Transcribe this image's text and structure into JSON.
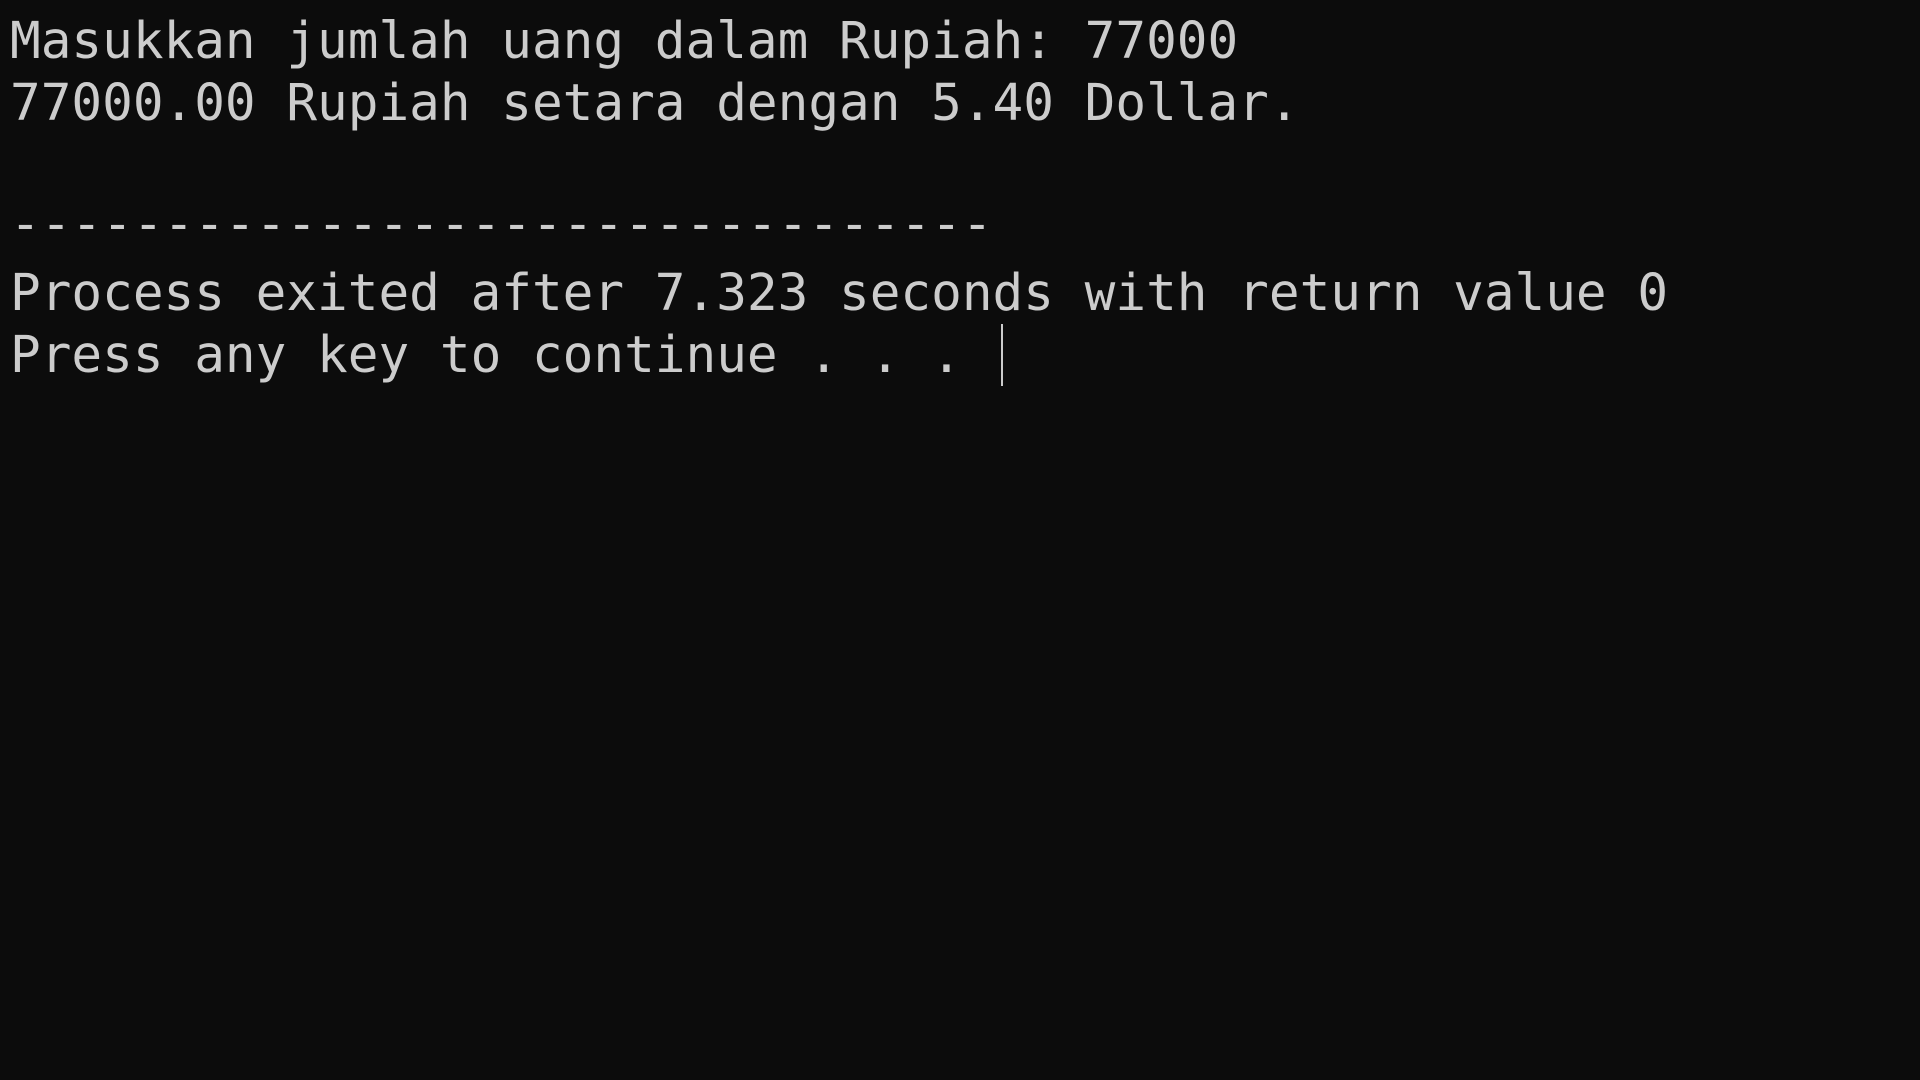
{
  "console": {
    "lines": [
      "Masukkan jumlah uang dalam Rupiah: 77000",
      "77000.00 Rupiah setara dengan 5.40 Dollar.",
      "--------------------------------",
      "Process exited after 7.323 seconds with return value 0",
      "Press any key to continue . . . "
    ]
  },
  "colors": {
    "background": "#0c0c0c",
    "text": "#cccccc"
  }
}
